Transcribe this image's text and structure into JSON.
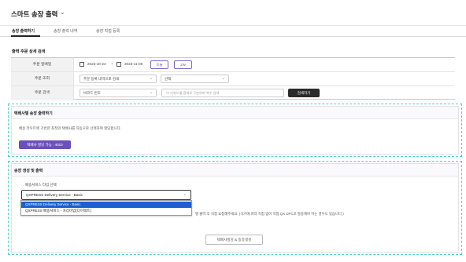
{
  "app": {
    "title": "스마트 송장 출력"
  },
  "tabs": [
    {
      "label": "송장 출력하기",
      "active": true
    },
    {
      "label": "송장 출력 내역",
      "active": false
    },
    {
      "label": "송장 직접 등록",
      "active": false
    }
  ],
  "search_section": {
    "title": "출력 주문 상세 검색",
    "order_date": {
      "label": "주문 일배일",
      "start": "2023-10-24",
      "separator": "~",
      "end": "2023-11-08",
      "btn_today": "오늘",
      "btn_2w": "2W"
    },
    "order_lookup": {
      "label": "주문 조회",
      "select1": "주문 등록 내역으로 검색",
      "select2": "선택"
    },
    "order_search": {
      "label": "주문 검색",
      "select": "바코드 번호",
      "placeholder": "이 키워드를 콤마로 구분하여 복수 검색",
      "button": "검색하기"
    }
  },
  "carrier_panel": {
    "title": "택배사별 송장 출력하기",
    "desc": "배송 라우트에 기반한 최적의 택배사를 자동으로 선택하여 할당합니다.",
    "button": "택배사 할당 가능 : 4010"
  },
  "generate_panel": {
    "title": "송장 생성 및 출력",
    "field_label": "배송서비스 타입 선택",
    "selected_value": "QXPRESS Delivery Service - Basic",
    "options": [
      "QXPRESS Delivery Service - Basic",
      "QXPRESS 배송서비스 - 프리미엄(다이렉트)"
    ],
    "notice": "별 출력 후 직접 요청해주세요. (국가에 따라 직접 없이 직접 QX DPC로 발송해야 하는 경우도 있습니다.)",
    "button": "택배사할당 & 송장생성"
  },
  "colors": {
    "accent": "#6b4fbb",
    "dashed": "#4dd2cd",
    "select_highlight": "#1b5fd0"
  }
}
